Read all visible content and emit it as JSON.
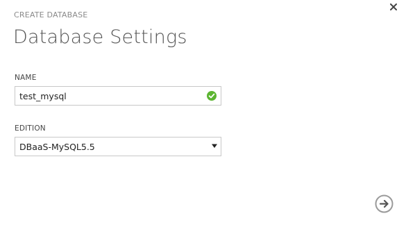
{
  "dialog": {
    "subtitle": "CREATE DATABASE",
    "title": "Database Settings"
  },
  "form": {
    "name": {
      "label": "NAME",
      "value": "test_mysql",
      "status_icon": "check-circle-icon",
      "status_color": "#5cb531"
    },
    "edition": {
      "label": "EDITION",
      "selected": "DBaaS-MySQL5.5",
      "icon": "dropdown-arrow-icon"
    }
  },
  "actions": {
    "close_icon": "close-icon",
    "next_icon": "arrow-right-circle-icon"
  },
  "colors": {
    "title": "#555555",
    "subtitle": "#8a8a8a",
    "border": "#c8c8c8",
    "icon_gray": "#9a9a9a"
  }
}
